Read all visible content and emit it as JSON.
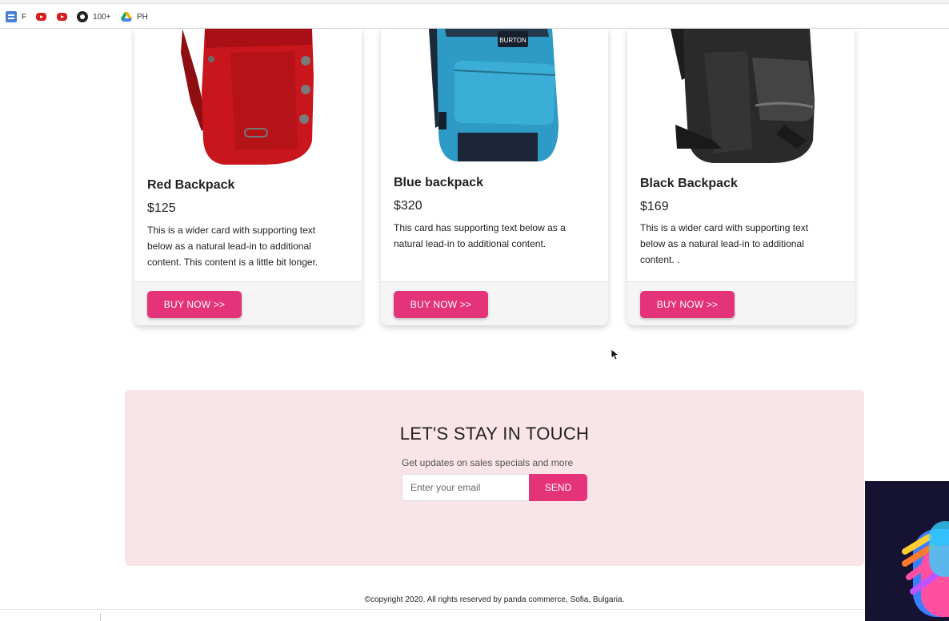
{
  "bookmarks": [
    {
      "icon": "docs-icon",
      "label": "F"
    },
    {
      "icon": "youtube-icon",
      "label": ""
    },
    {
      "icon": "youtube-icon",
      "label": ""
    },
    {
      "icon": "github-icon",
      "label": "100+"
    },
    {
      "icon": "drive-icon",
      "label": "PH"
    }
  ],
  "products": [
    {
      "title": "Red Backpack",
      "price": "$125",
      "description": "This is a wider card with supporting text below as a natural lead-in to additional content. This content is a little bit longer.",
      "button": "BUY NOW >>",
      "color": "#c8161c"
    },
    {
      "title": "Blue backpack",
      "price": "$320",
      "description": "This card has supporting text below as a natural lead-in to additional content.",
      "button": "BUY NOW >>",
      "color": "#2e9bc6",
      "brand": "BURTON"
    },
    {
      "title": "Black Backpack",
      "price": "$169",
      "description": "This is a wider card with supporting text below as a natural lead-in to additional content. .",
      "button": "BUY NOW >>",
      "color": "#2a2a2a"
    }
  ],
  "newsletter": {
    "heading": "LET'S STAY IN TOUCH",
    "subtitle": "Get updates on sales specials and more",
    "email_placeholder": "Enter your email",
    "send_label": "SEND"
  },
  "footer": {
    "copyright": "©copyright 2020. All rights reserved by panda commerce, Sofia, Bulgaria."
  },
  "colors": {
    "accent": "#e5337a",
    "newsletter_bg": "#f9e4e7"
  }
}
